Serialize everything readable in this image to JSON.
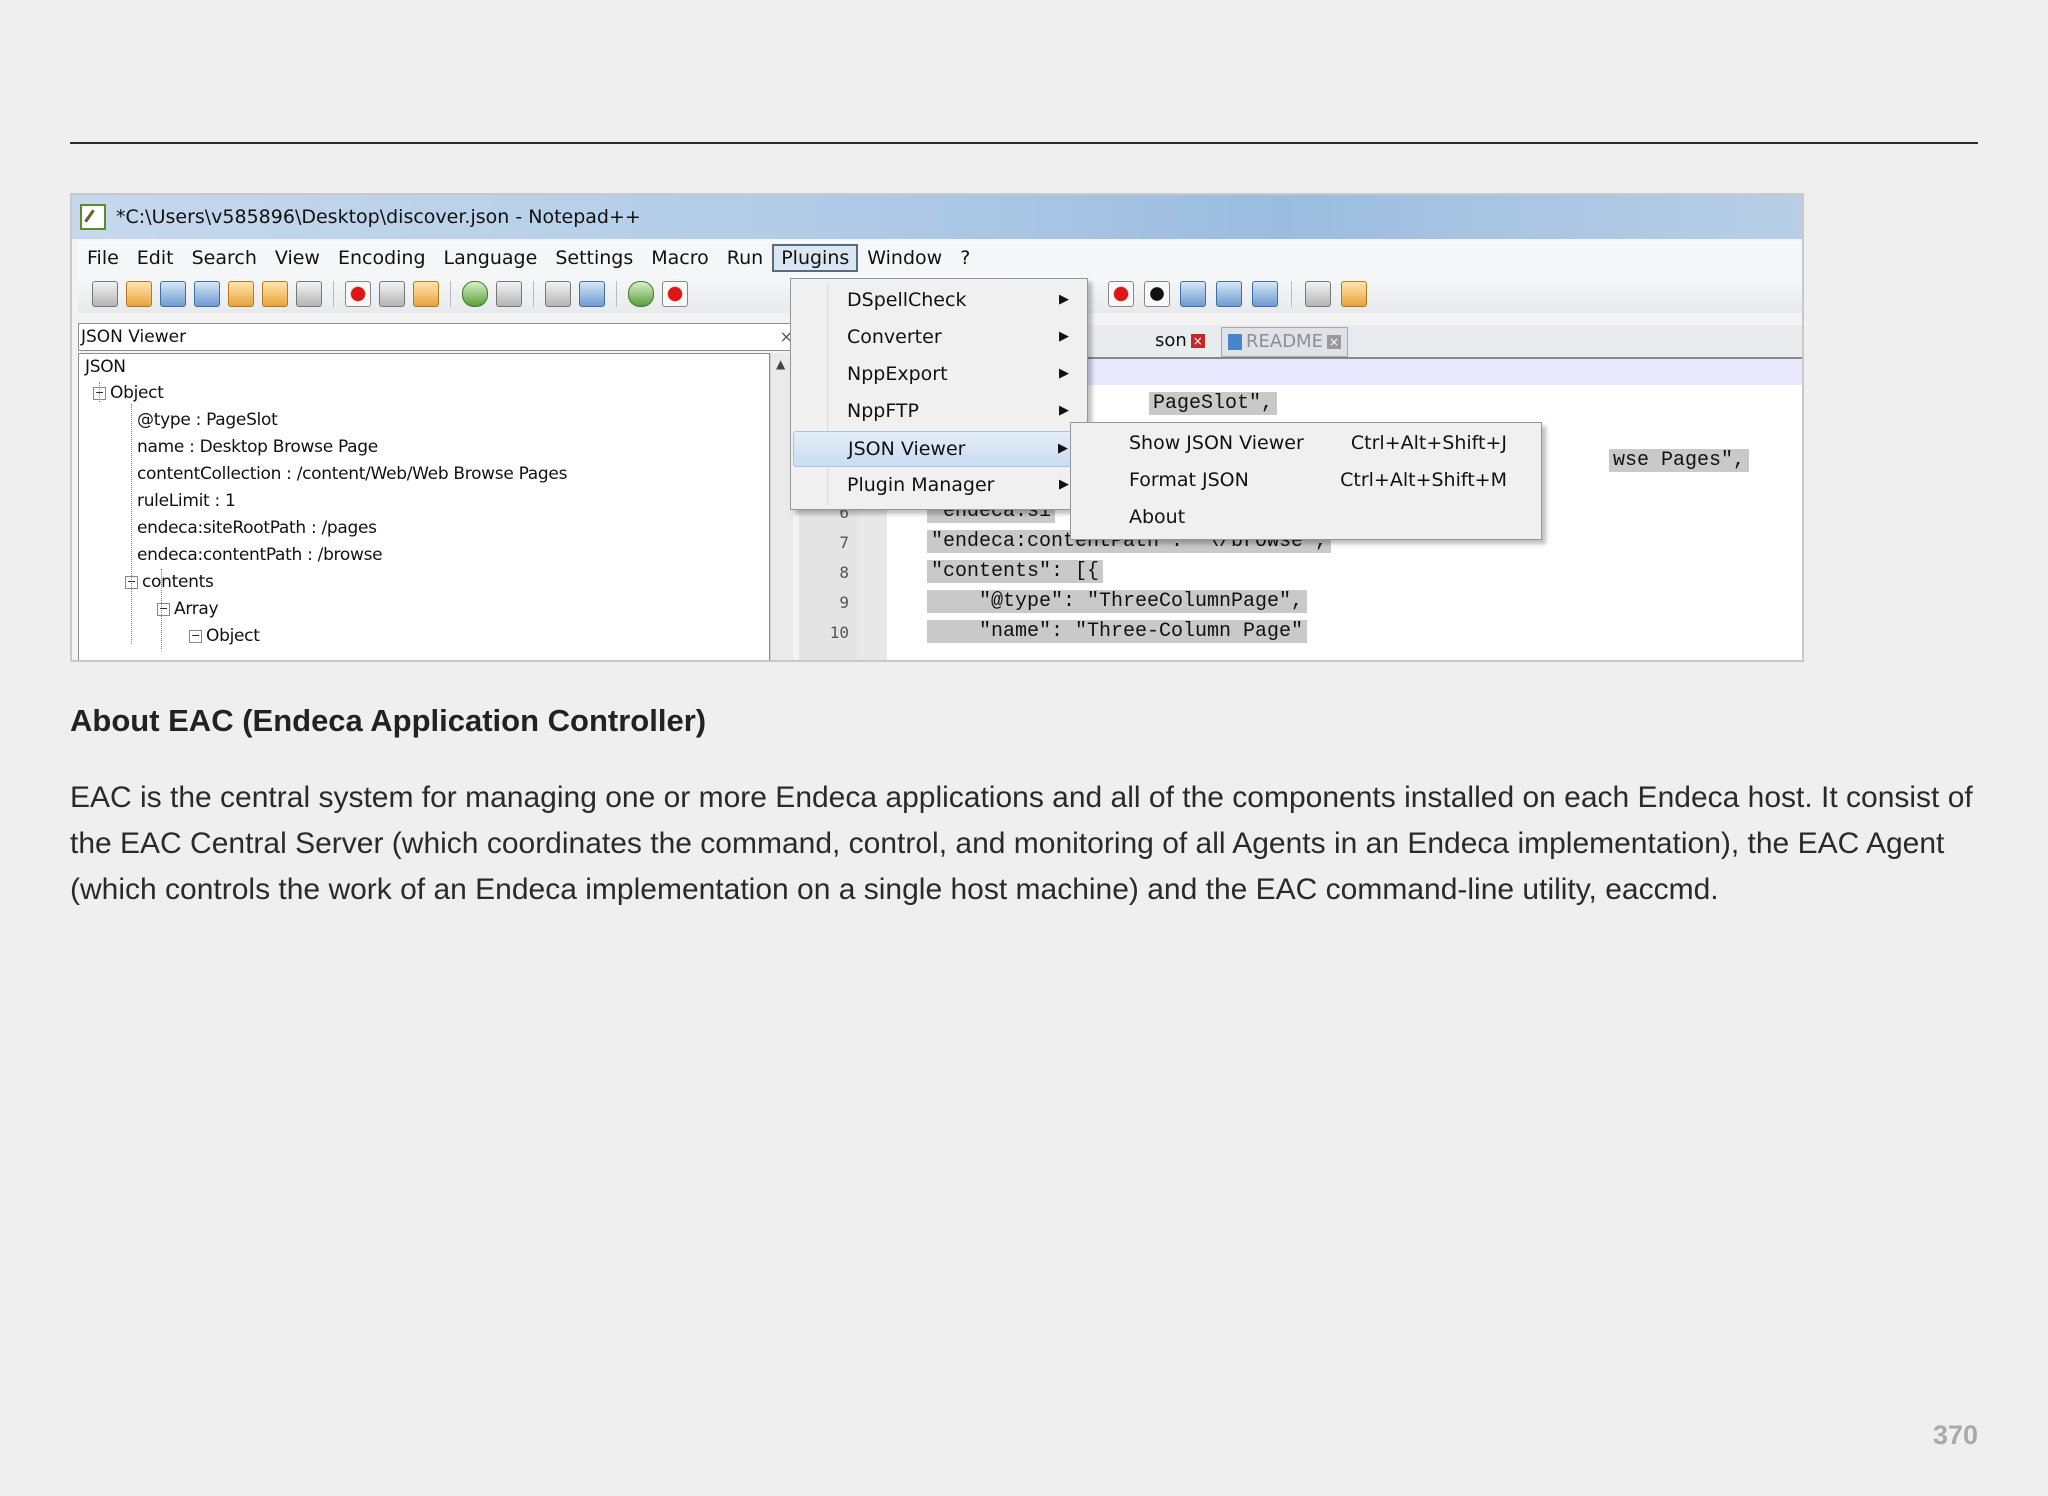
{
  "window": {
    "title": "*C:\\Users\\v585896\\Desktop\\discover.json - Notepad++"
  },
  "menubar": [
    {
      "label": "File"
    },
    {
      "label": "Edit"
    },
    {
      "label": "Search"
    },
    {
      "label": "View"
    },
    {
      "label": "Encoding"
    },
    {
      "label": "Language"
    },
    {
      "label": "Settings"
    },
    {
      "label": "Macro"
    },
    {
      "label": "Run"
    },
    {
      "label": "Plugins",
      "active": true
    },
    {
      "label": "Window"
    },
    {
      "label": "?"
    }
  ],
  "json_viewer_panel": {
    "title": "JSON Viewer",
    "close_glyph": "×",
    "tree": [
      {
        "text": "JSON"
      },
      {
        "text": "Object"
      },
      {
        "text": "@type : PageSlot"
      },
      {
        "text": "name : Desktop Browse Page"
      },
      {
        "text": "contentCollection : /content/Web/Web Browse Pages"
      },
      {
        "text": "ruleLimit : 1"
      },
      {
        "text": "endeca:siteRootPath : /pages"
      },
      {
        "text": "endeca:contentPath : /browse"
      },
      {
        "text": "contents"
      },
      {
        "text": "Array"
      },
      {
        "text": "Object"
      }
    ]
  },
  "editor": {
    "tabs": [
      {
        "label": "son"
      },
      {
        "label": "README"
      }
    ],
    "lines": [
      {
        "num": "",
        "text": "PageSlot\","
      },
      {
        "num": "",
        "text": "wse Pages\","
      },
      {
        "num": "6",
        "text": "\"endeca:si"
      },
      {
        "num": "7",
        "text": "\"endeca:contentPath\": \"\\/browse\","
      },
      {
        "num": "8",
        "text": "\"contents\": [{"
      },
      {
        "num": "9",
        "text": "    \"@type\": \"ThreeColumnPage\","
      },
      {
        "num": "10",
        "text": "    \"name\": \"Three-Column Page\""
      }
    ]
  },
  "plugins_menu": [
    {
      "label": "DSpellCheck"
    },
    {
      "label": "Converter"
    },
    {
      "label": "NppExport"
    },
    {
      "label": "NppFTP"
    },
    {
      "label": "JSON Viewer",
      "selected": true
    },
    {
      "label": "Plugin Manager"
    }
  ],
  "json_viewer_submenu": [
    {
      "label": "Show JSON Viewer",
      "shortcut": "Ctrl+Alt+Shift+J"
    },
    {
      "label": "Format JSON",
      "shortcut": "Ctrl+Alt+Shift+M"
    },
    {
      "label": "About",
      "shortcut": ""
    }
  ],
  "document": {
    "heading": "About EAC (Endeca Application Controller)",
    "paragraph": "EAC is the central system for managing one or more Endeca applications and all of the components installed on each Endeca host. It consist of the EAC Central Server (which coordinates the command, control, and monitoring of all Agents in an Endeca implementation), the EAC Agent (which controls the work of an Endeca implementation on a single host machine) and the EAC command-line utility, eaccmd.",
    "page_number": "370"
  },
  "colors": {
    "accent_selection": "#c9dcf2",
    "code_highlight": "#c9c9c9",
    "page_background": "#efeff0"
  }
}
